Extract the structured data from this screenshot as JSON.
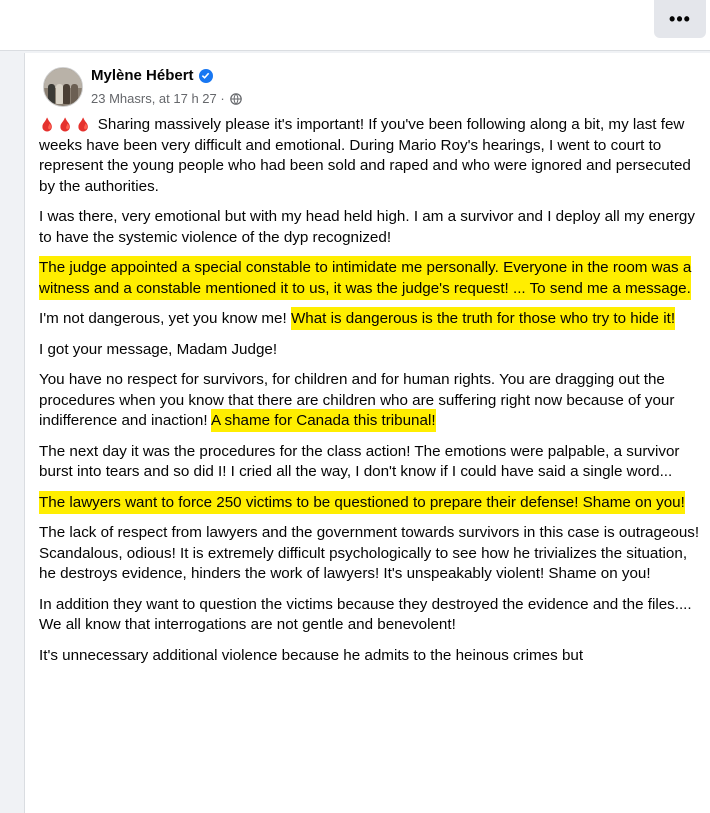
{
  "topbar": {
    "more_label": "•••"
  },
  "post": {
    "author": "Mylène Hébert",
    "timestamp": "23 Mhasrs, at 17 h 27 ·",
    "emoji": "🩸🩸🩸",
    "paragraphs": [
      {
        "segments": [
          {
            "text": " Sharing massively please it's important! If you've been following along a bit, my last few weeks have been very difficult and emotional. During Mario Roy's hearings, I went to court to represent the young people who had been sold and raped and who were ignored and persecuted by the authorities.",
            "hl": false
          }
        ]
      },
      {
        "segments": [
          {
            "text": "I was there, very emotional but with my head held high. I am a survivor and I deploy all my energy to have the systemic violence of the dyp recognized!",
            "hl": false
          }
        ]
      },
      {
        "segments": [
          {
            "text": "The judge appointed a special constable to intimidate me personally. Everyone in the room was a witness and a constable mentioned it to us, it was the judge's request! ... To send me a message.",
            "hl": true
          }
        ]
      },
      {
        "segments": [
          {
            "text": "I'm not dangerous, yet you know me! ",
            "hl": false
          },
          {
            "text": "What is dangerous is the truth for those who try to hide it!",
            "hl": true
          }
        ]
      },
      {
        "segments": [
          {
            "text": "I got your message, Madam Judge!",
            "hl": false
          }
        ]
      },
      {
        "segments": [
          {
            "text": "You have no respect for survivors, for children and for human rights. You are dragging out the procedures when you know that there are children who are suffering right now because of your indifference and inaction! ",
            "hl": false
          },
          {
            "text": "A shame for Canada this tribunal!",
            "hl": true
          }
        ]
      },
      {
        "segments": [
          {
            "text": "The next day it was the procedures for the class action! The emotions were palpable, a survivor burst into tears and so did I! I cried all the way, I don't know if I could have said a single word...",
            "hl": false
          }
        ]
      },
      {
        "segments": [
          {
            "text": "The lawyers want to force 250 victims to be questioned to prepare their defense! Shame on you!",
            "hl": true
          }
        ]
      },
      {
        "segments": [
          {
            "text": "The lack of respect from lawyers and the government towards survivors in this case is outrageous! Scandalous, odious! It is extremely difficult psychologically to see how he trivializes the situation, he destroys evidence, hinders the work of lawyers! It's unspeakably violent! Shame on you!",
            "hl": false
          }
        ]
      },
      {
        "segments": [
          {
            "text": "In addition they want to question the victims because they destroyed the evidence and the files.... We all know that interrogations are not gentle and benevolent!",
            "hl": false
          }
        ]
      },
      {
        "segments": [
          {
            "text": "It's unnecessary additional violence because he admits to the heinous crimes but",
            "hl": false
          }
        ]
      }
    ]
  },
  "colors": {
    "highlight": "#ffee00",
    "verified": "#1877f2",
    "meta_text": "#65676b"
  },
  "icons": {
    "verified": "verified-badge-icon",
    "audience": "globe-icon",
    "more": "more-options-icon"
  }
}
